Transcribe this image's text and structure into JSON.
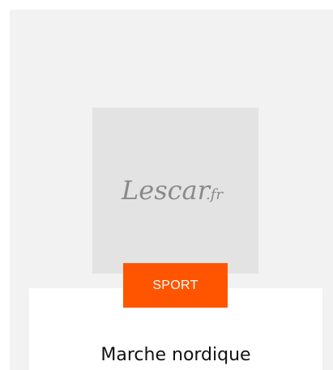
{
  "card": {
    "logo": {
      "main": "Lescar",
      "tld": ".fr"
    },
    "category": "SPORT",
    "title": "Marche nordique"
  },
  "colors": {
    "badge_bg": "#ff5500",
    "outer_bg": "#f2f2f2",
    "thumb_bg": "#e3e3e3",
    "logo": "#8a8a8a"
  }
}
